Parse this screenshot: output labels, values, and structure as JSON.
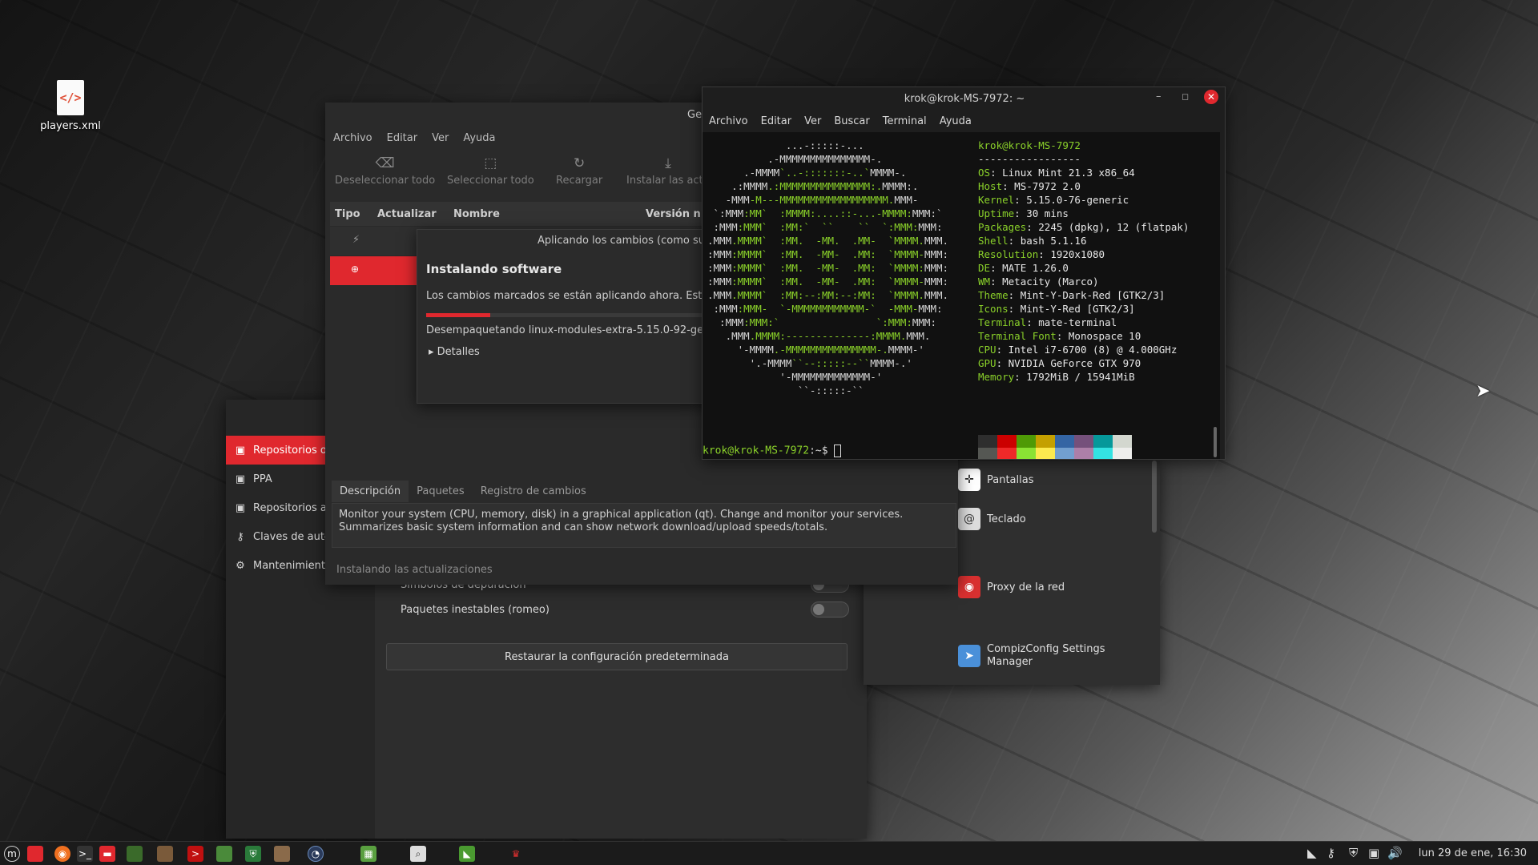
{
  "desktop": {
    "icon_label": "players.xml",
    "icon_name": "xml-file-icon"
  },
  "update_manager": {
    "title": "Gestor de actualizaciones",
    "menu": [
      "Archivo",
      "Editar",
      "Ver",
      "Ayuda"
    ],
    "toolbar": {
      "deselect": "Deseleccionar todo",
      "select": "Seleccionar todo",
      "reload": "Recargar",
      "install": "Instalar las actu"
    },
    "columns": {
      "type": "Tipo",
      "update": "Actualizar",
      "name": "Nombre",
      "version": "Versión n"
    },
    "tabs": [
      "Descripción",
      "Paquetes",
      "Registro de cambios"
    ],
    "description": "Monitor your system (CPU, memory, disk) in a graphical application (qt). Change and monitor your services. Summarizes basic system information and can show network download/upload speeds/totals.",
    "status": "Instalando las actualizaciones"
  },
  "apply_dialog": {
    "title": "Aplicando los cambios (como supe",
    "heading": "Instalando software",
    "message": "Los cambios marcados se están aplicando ahora. Esto pue",
    "progress": 0.2,
    "action": "Desempaquetando linux-modules-extra-5.15.0-92-generi",
    "details": "Detalles"
  },
  "software_sources": {
    "sidebar": [
      "Repositorios ofi",
      "PPA",
      "Repositorios ad",
      "Claves de auten",
      "Mantenimiento"
    ],
    "options": [
      "Símbolos de depuración",
      "Paquetes inestables (romeo)"
    ],
    "restore": "Restaurar la configuración predeterminada"
  },
  "control_center": {
    "items": [
      "Pantallas",
      "Teclado",
      "Proxy de la red",
      "CompizConfig Settings Manager"
    ]
  },
  "terminal": {
    "title": "krok@krok-MS-7972: ~",
    "menu": [
      "Archivo",
      "Editar",
      "Ver",
      "Buscar",
      "Terminal",
      "Ayuda"
    ],
    "user": "krok@krok-MS-7972",
    "separator": "-----------------",
    "info": [
      {
        "k": "OS",
        "v": "Linux Mint 21.3 x86_64"
      },
      {
        "k": "Host",
        "v": "MS-7972 2.0"
      },
      {
        "k": "Kernel",
        "v": "5.15.0-76-generic"
      },
      {
        "k": "Uptime",
        "v": "30 mins"
      },
      {
        "k": "Packages",
        "v": "2245 (dpkg), 12 (flatpak)"
      },
      {
        "k": "Shell",
        "v": "bash 5.1.16"
      },
      {
        "k": "Resolution",
        "v": "1920x1080"
      },
      {
        "k": "DE",
        "v": "MATE 1.26.0"
      },
      {
        "k": "WM",
        "v": "Metacity (Marco)"
      },
      {
        "k": "Theme",
        "v": "Mint-Y-Dark-Red [GTK2/3]"
      },
      {
        "k": "Icons",
        "v": "Mint-Y-Red [GTK2/3]"
      },
      {
        "k": "Terminal",
        "v": "mate-terminal"
      },
      {
        "k": "Terminal Font",
        "v": "Monospace 10"
      },
      {
        "k": "CPU",
        "v": "Intel i7-6700 (8) @ 4.000GHz"
      },
      {
        "k": "GPU",
        "v": "NVIDIA GeForce GTX 970"
      },
      {
        "k": "Memory",
        "v": "1792MiB / 15941MiB"
      }
    ],
    "prompt": "krok@krok-MS-7972",
    "prompt_suffix": ":~$",
    "palette": [
      "#2e2e2e",
      "#cc0000",
      "#4e9a06",
      "#c4a000",
      "#3465a4",
      "#75507b",
      "#06989a",
      "#d3d7cf",
      "#555753",
      "#ef2929",
      "#8ae234",
      "#fce94f",
      "#729fcf",
      "#ad7fa8",
      "#34e2e2",
      "#eeeeec"
    ]
  },
  "panel": {
    "clock": "lun 29 de ene, 16:30"
  }
}
